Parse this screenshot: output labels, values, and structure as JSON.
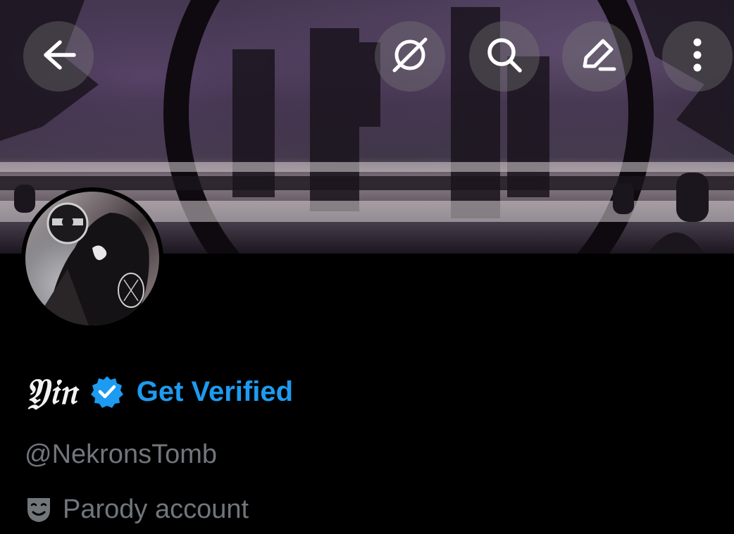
{
  "header": {
    "back_icon": "arrow-left-icon",
    "grok_icon": "grok-slash-icon",
    "search_icon": "search-icon",
    "edit_icon": "pencil-icon",
    "more_icon": "more-vertical-icon"
  },
  "profile": {
    "display_name": "𝔜𝔦𝔫",
    "get_verified_label": "Get Verified",
    "handle": "@NekronsTomb",
    "account_label": "Parody account",
    "account_label_icon": "theater-mask-icon"
  },
  "colors": {
    "accent": "#1d9bf0",
    "muted_text": "#71767b",
    "background": "#000000"
  }
}
